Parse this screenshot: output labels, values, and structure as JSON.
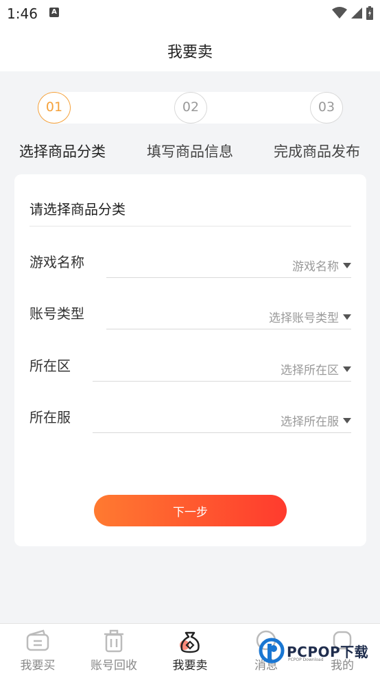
{
  "status_bar": {
    "time": "1:46",
    "notification_icon": "a-icon"
  },
  "header": {
    "title": "我要卖"
  },
  "stepper": {
    "steps": [
      {
        "number": "01",
        "label": "选择商品分类",
        "active": true
      },
      {
        "number": "02",
        "label": "填写商品信息",
        "active": false
      },
      {
        "number": "03",
        "label": "完成商品发布",
        "active": false
      }
    ]
  },
  "form": {
    "title": "请选择商品分类",
    "fields": [
      {
        "label": "游戏名称",
        "placeholder": "游戏名称"
      },
      {
        "label": "账号类型",
        "placeholder": "选择账号类型"
      },
      {
        "label": "所在区",
        "placeholder": "选择所在区"
      },
      {
        "label": "所在服",
        "placeholder": "选择所在服"
      }
    ],
    "next_button": "下一步"
  },
  "bottom_nav": {
    "items": [
      {
        "label": "我要买",
        "icon": "wallet-icon",
        "active": false
      },
      {
        "label": "账号回收",
        "icon": "trash-icon",
        "active": false
      },
      {
        "label": "我要卖",
        "icon": "money-bag-icon",
        "active": true
      },
      {
        "label": "消息",
        "icon": "message-icon",
        "active": false
      },
      {
        "label": "我的",
        "icon": "profile-icon",
        "active": false
      }
    ]
  },
  "watermark": {
    "brand": "PCPOP下载",
    "sub": "PCPOP Download"
  },
  "colors": {
    "accent": "#f5a13a",
    "button_start": "#ff7a30",
    "button_end": "#ff3b2e"
  }
}
